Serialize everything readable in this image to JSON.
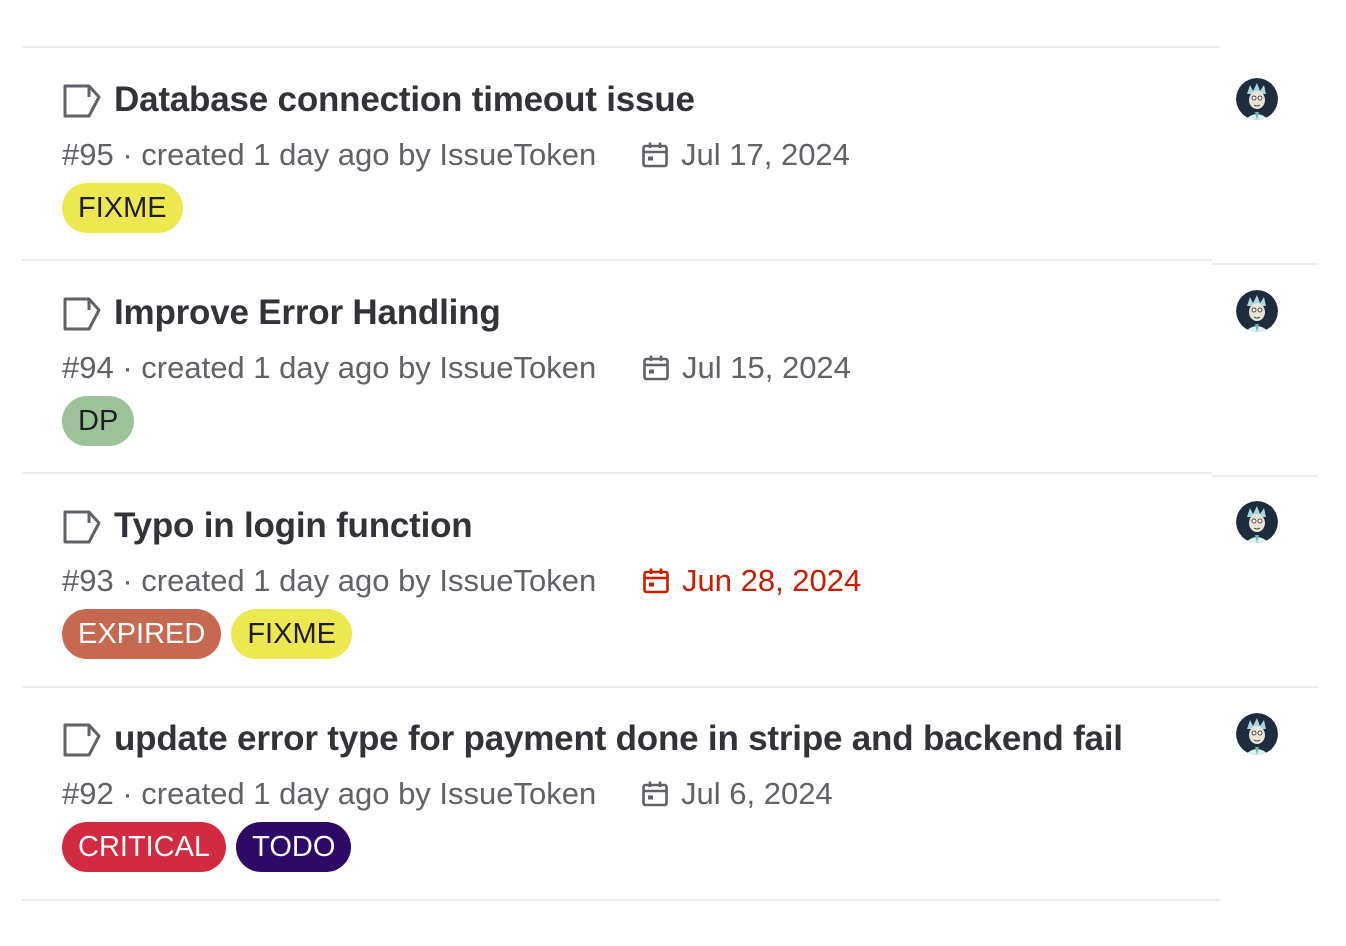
{
  "issues": [
    {
      "title": "Database connection timeout issue",
      "meta": "#95 · created 1 day ago by ",
      "author": "IssueToken",
      "due_date": "Jul 17, 2024",
      "due_expired": false,
      "labels": [
        {
          "text": "FIXME",
          "bg": "#ece84f",
          "fg": "#1f1e24"
        }
      ]
    },
    {
      "title": "Improve Error Handling",
      "meta": "#94 · created 1 day ago by ",
      "author": "IssueToken",
      "due_date": "Jul 15, 2024",
      "due_expired": false,
      "labels": [
        {
          "text": "DP",
          "bg": "#9dc198",
          "fg": "#1f1e24"
        }
      ]
    },
    {
      "title": "Typo in login function",
      "meta": "#93 · created 1 day ago by ",
      "author": "IssueToken",
      "due_date": "Jun 28, 2024",
      "due_expired": true,
      "labels": [
        {
          "text": "EXPIRED",
          "bg": "#c66950",
          "fg": "#ffffff"
        },
        {
          "text": "FIXME",
          "bg": "#ece84f",
          "fg": "#1f1e24"
        }
      ]
    },
    {
      "title": "update error type for payment done in stripe and backend fail",
      "meta": "#92 · created 1 day ago by ",
      "author": "IssueToken",
      "due_date": "Jul 6, 2024",
      "due_expired": false,
      "labels": [
        {
          "text": "CRITICAL",
          "bg": "#d22a3f",
          "fg": "#ffffff"
        },
        {
          "text": "TODO",
          "bg": "#2e0a67",
          "fg": "#ffffff"
        }
      ]
    }
  ],
  "colors": {
    "expired_date": "#c91c00",
    "meta_text": "#626168",
    "divider": "#ececef"
  },
  "icons": {
    "issue": "issue-open-icon",
    "due": "calendar-icon",
    "assignee": "assignee-avatar"
  }
}
